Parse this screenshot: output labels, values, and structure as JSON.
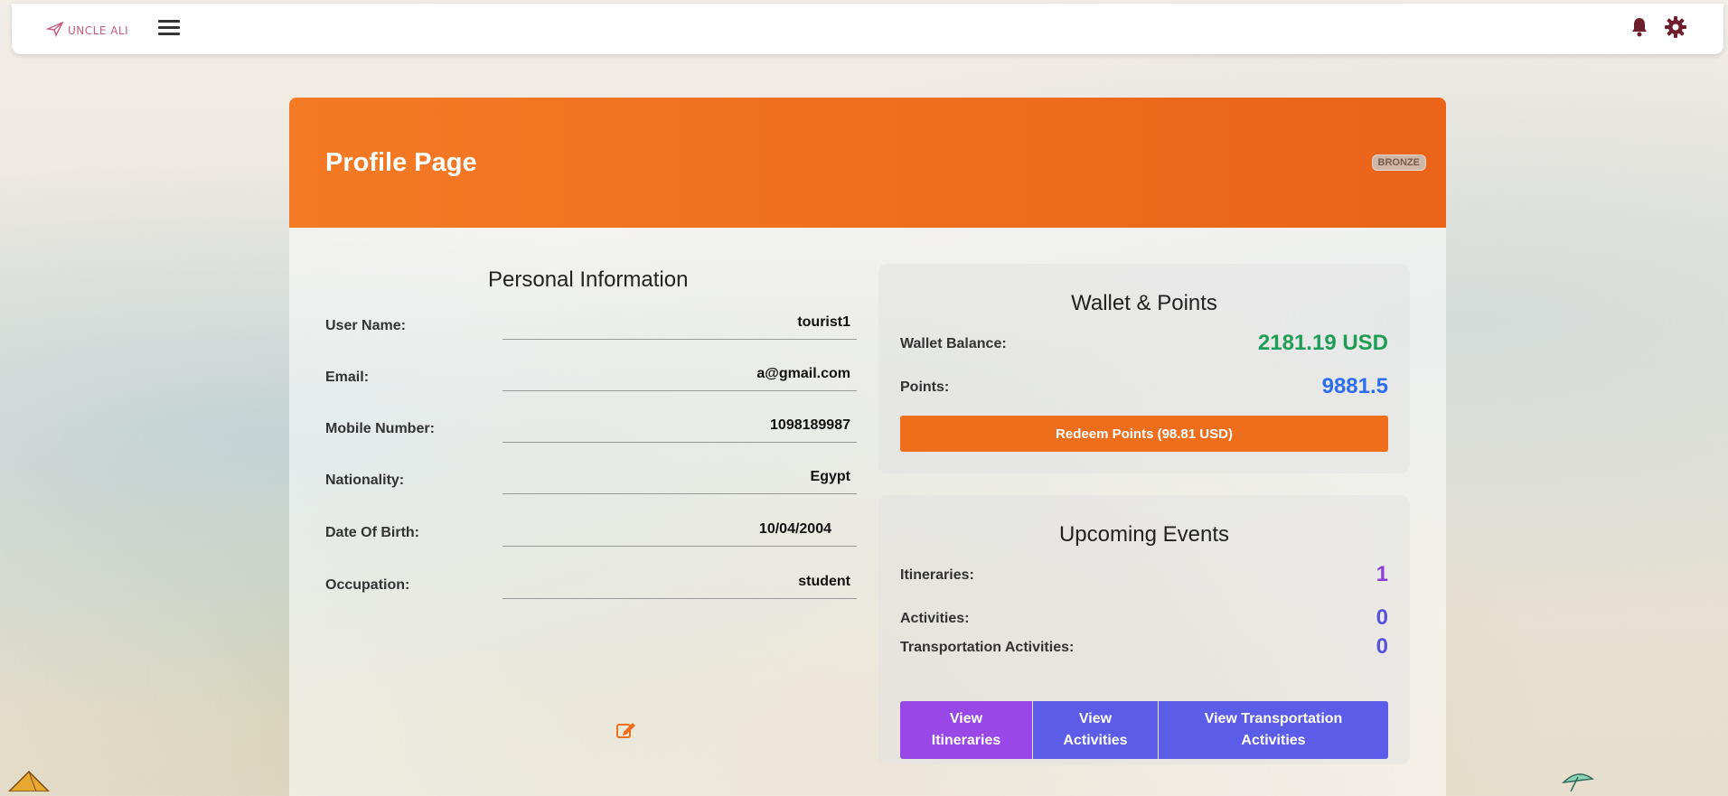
{
  "topbar": {
    "logo_text": "UNCLE ALI",
    "icons": {
      "logo": "plane-icon",
      "menu": "hamburger-icon",
      "notifications": "bell-icon",
      "settings": "gear-icon"
    }
  },
  "profile": {
    "title": "Profile Page",
    "tier_badge": "BRONZE"
  },
  "personal": {
    "title": "Personal Information",
    "fields": [
      {
        "label": "User Name:",
        "value": "tourist1"
      },
      {
        "label": "Email:",
        "value": "a@gmail.com"
      },
      {
        "label": "Mobile Number:",
        "value": "1098189987"
      },
      {
        "label": "Nationality:",
        "value": "Egypt"
      },
      {
        "label": "Date Of Birth:",
        "value": "10/04/2004"
      },
      {
        "label": "Occupation:",
        "value": "student"
      }
    ]
  },
  "wallet": {
    "title": "Wallet & Points",
    "balance_label": "Wallet Balance:",
    "balance_value": "2181.19 USD",
    "points_label": "Points:",
    "points_value": "9881.5",
    "redeem_label": "Redeem Points (98.81 USD)"
  },
  "events": {
    "title": "Upcoming Events",
    "itineraries_label": "Itineraries:",
    "itineraries_count": "1",
    "activities_label": "Activities:",
    "activities_count": "0",
    "transport_label": "Transportation Activities:",
    "transport_count": "0",
    "view_itineraries": [
      "View",
      "Itineraries"
    ],
    "view_activities": [
      "View",
      "Activities"
    ],
    "view_transport": [
      "View Transportation",
      "Activities"
    ]
  },
  "colors": {
    "header_orange": "#f47a25",
    "balance_green": "#1f9d57",
    "points_blue": "#2d6ef0",
    "itineraries_purple": "#8b3fd9",
    "activities_indigo": "#5b4fe0",
    "btn_purple": "#9947e6",
    "btn_indigo": "#5b5de8"
  }
}
